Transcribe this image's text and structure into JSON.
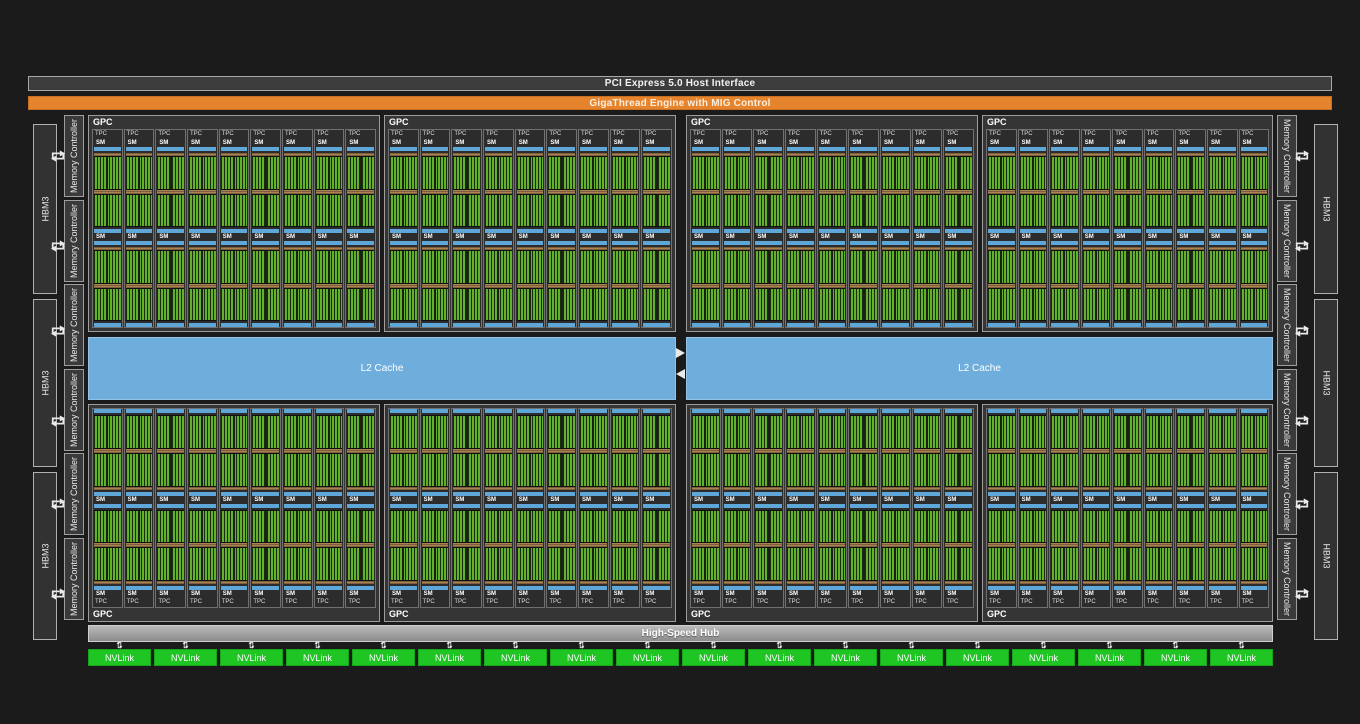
{
  "top_bars": {
    "pcie": "PCI Express 5.0 Host Interface",
    "gigathread": "GigaThread Engine with MIG Control"
  },
  "gpu": {
    "gpc_label": "GPC",
    "tpc_label": "TPC",
    "sm_label": "SM",
    "l2_label": "L2 Cache",
    "gpc_count": 8,
    "tpc_per_gpc": 9,
    "sm_per_tpc": 2,
    "l2_partitions": 2
  },
  "memory": {
    "hbm_label": "HBM3",
    "hbm_stacks_per_side": 3,
    "mc_label": "Memory Controller",
    "mc_per_side": 6
  },
  "bottom": {
    "hub_label": "High-Speed Hub",
    "nvlink_label": "NVLink",
    "nvlink_count": 18
  },
  "icons": {
    "hbm_mc_link": "swap-arrows-icon",
    "l2_link_top": "arrow-right-icon",
    "l2_link_bottom": "arrow-left-icon",
    "nvlink_link": "swap-arrows-icon"
  },
  "colors": {
    "background": "#1b1b1b",
    "pcie_bar": "#3d3d3d",
    "gigathread_orange": "#e6832d",
    "gpc_fill": "#353535",
    "gpc_border": "#9c9c9c",
    "sm_blue_bar": "#5ea7d8",
    "sm_core_green": "#63b02c",
    "sm_register_tan": "#aa8252",
    "l2_blue": "#6faedc",
    "hub_gray": "#a3a3a3",
    "nvlink_green": "#1fc623"
  }
}
